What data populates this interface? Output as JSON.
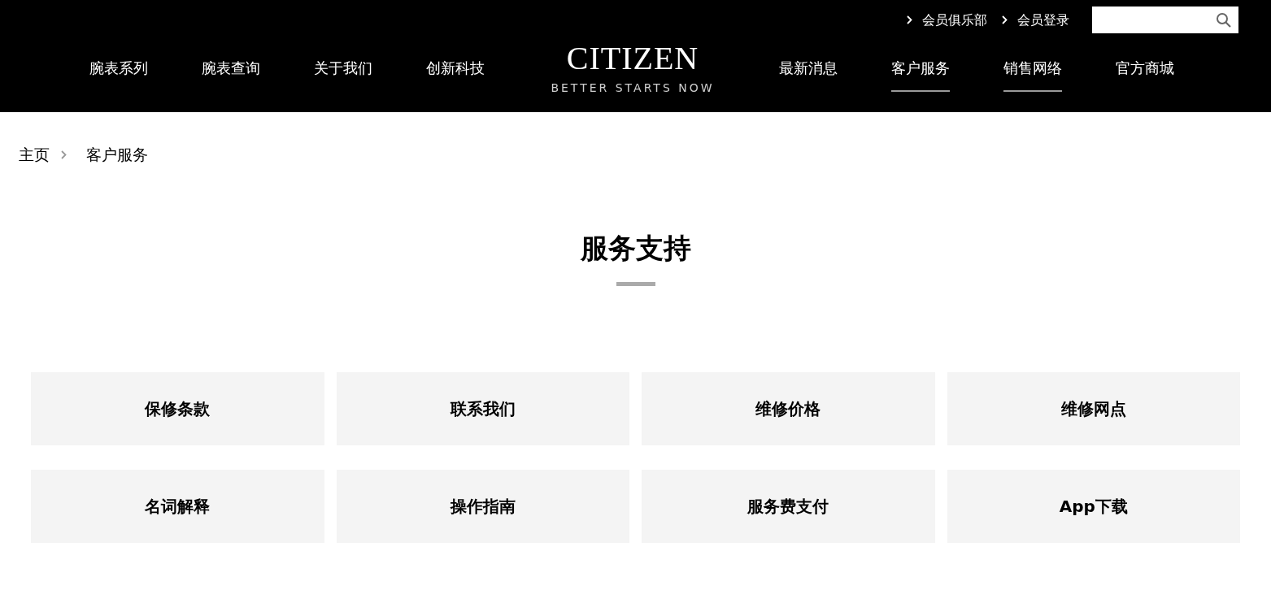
{
  "header": {
    "top_links": [
      "会员俱乐部",
      "会员登录"
    ],
    "nav_left": [
      {
        "label": "腕表系列",
        "selected": false
      },
      {
        "label": "腕表查询",
        "selected": false
      },
      {
        "label": "关于我们",
        "selected": false
      },
      {
        "label": "创新科技",
        "selected": false
      }
    ],
    "logo": {
      "brand": "CITIZEN",
      "tagline": "BETTER STARTS NOW"
    },
    "nav_right": [
      {
        "label": "最新消息",
        "selected": false
      },
      {
        "label": "客户服务",
        "selected": true
      },
      {
        "label": "销售网络",
        "selected": true
      },
      {
        "label": "官方商城",
        "selected": false
      }
    ]
  },
  "breadcrumb": [
    "主页",
    "客户服务"
  ],
  "section": {
    "title": "服务支持",
    "tiles": [
      "保修条款",
      "联系我们",
      "维修价格",
      "维修网点",
      "名词解释",
      "操作指南",
      "服务费支付",
      "App下载"
    ]
  }
}
